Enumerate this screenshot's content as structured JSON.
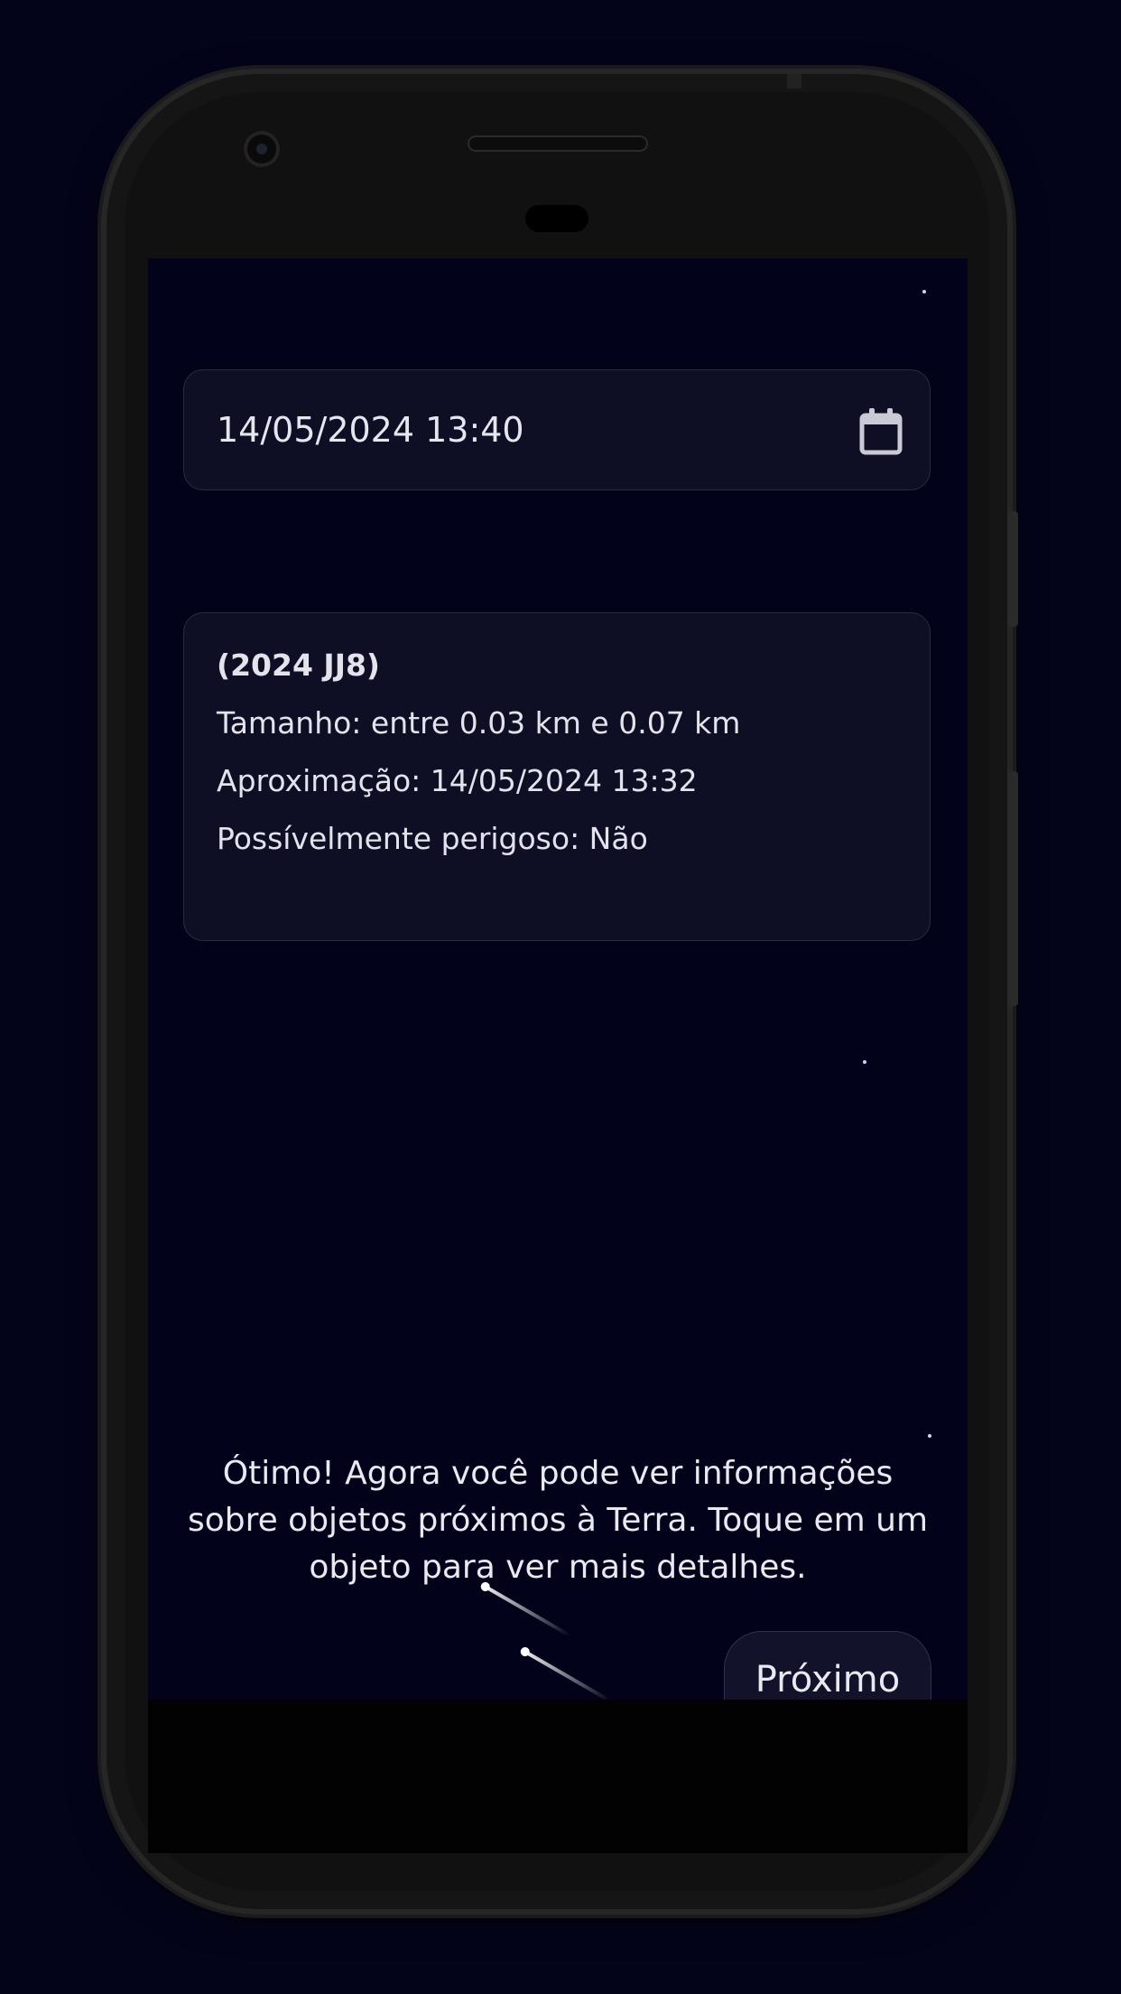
{
  "date_field": {
    "value": "14/05/2024 13:40",
    "icon": "calendar-icon"
  },
  "neo_card": {
    "name": "(2024 JJ8)",
    "size": "Tamanho: entre 0.03 km e 0.07 km",
    "approach": "Aproximação: 14/05/2024 13:32",
    "hazardous": "Possívelmente perigoso: Não"
  },
  "tutorial": {
    "message": "Ótimo! Agora você pode ver informações sobre objetos próximos à Terra. Toque em um objeto para ver mais detalhes.",
    "next_label": "Próximo"
  },
  "colors": {
    "background": "#03041a",
    "card": "#0e0f24",
    "text": "#e6e6ee"
  }
}
